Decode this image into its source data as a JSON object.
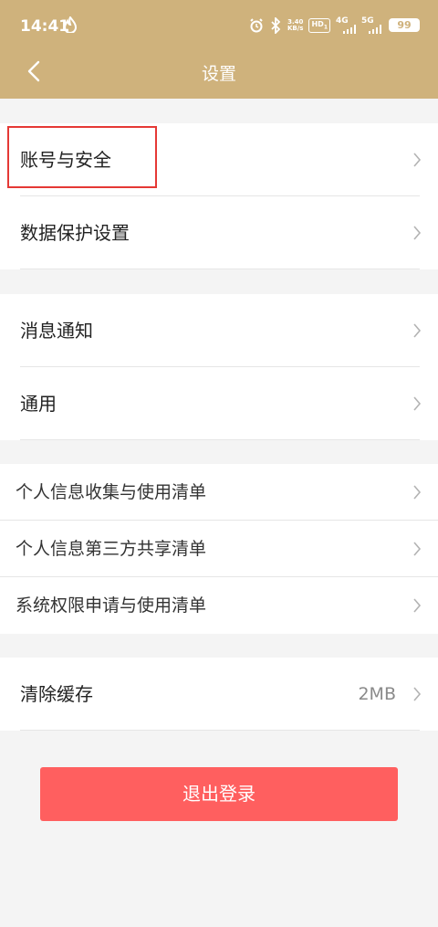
{
  "status_bar": {
    "time": "14:41",
    "net_speed_top": "3.40",
    "net_speed_bottom": "KB/s",
    "hd_label": "HD",
    "sim1": "1",
    "net1": "4G",
    "net2": "5G",
    "battery": "99"
  },
  "header": {
    "title": "设置",
    "background": "#cfb27c"
  },
  "groups": [
    {
      "items": [
        {
          "label": "账号与安全"
        },
        {
          "label": "数据保护设置"
        }
      ]
    },
    {
      "items": [
        {
          "label": "消息通知"
        },
        {
          "label": "通用"
        }
      ]
    },
    {
      "items": [
        {
          "label": "个人信息收集与使用清单"
        },
        {
          "label": "个人信息第三方共享清单"
        },
        {
          "label": "系统权限申请与使用清单"
        }
      ]
    },
    {
      "items": [
        {
          "label": "清除缓存",
          "value": "2MB"
        }
      ]
    }
  ],
  "logout": {
    "label": "退出登录",
    "color": "#ff5f5f"
  },
  "highlight_color": "#e53935"
}
